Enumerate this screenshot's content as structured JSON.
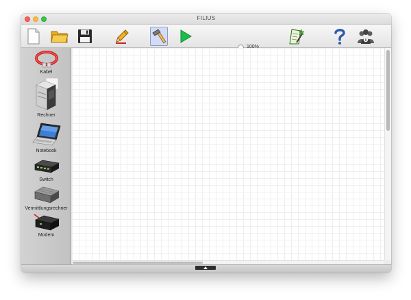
{
  "window": {
    "title": "FILIUS"
  },
  "toolbar": {
    "buttons": [
      {
        "name": "new-file",
        "icon": "new-file-icon"
      },
      {
        "name": "open-folder",
        "icon": "folder-icon"
      },
      {
        "name": "save",
        "icon": "floppy-disk-icon"
      },
      {
        "name": "design-mode",
        "icon": "pencil-icon"
      },
      {
        "name": "build-mode",
        "icon": "hammer-icon",
        "active": true
      },
      {
        "name": "simulation-mode",
        "icon": "play-icon"
      },
      {
        "name": "documentation",
        "icon": "wizard-icon"
      },
      {
        "name": "help",
        "icon": "question-mark-icon"
      },
      {
        "name": "info",
        "icon": "users-info-icon"
      }
    ],
    "zoom": {
      "label": "100%",
      "value": 100
    }
  },
  "palette": {
    "items": [
      {
        "label": "Kabel",
        "icon": "cable-icon"
      },
      {
        "label": "Rechner",
        "icon": "computer-icon"
      },
      {
        "label": "Notebook",
        "icon": "notebook-icon"
      },
      {
        "label": "Switch",
        "icon": "switch-icon"
      },
      {
        "label": "Vermittlungsrechner",
        "icon": "router-icon"
      },
      {
        "label": "Modem",
        "icon": "modem-icon"
      }
    ]
  },
  "colors": {
    "accent_active": "#d3dcf5",
    "play_green": "#1dbb4c",
    "cable_red": "#d42020"
  }
}
